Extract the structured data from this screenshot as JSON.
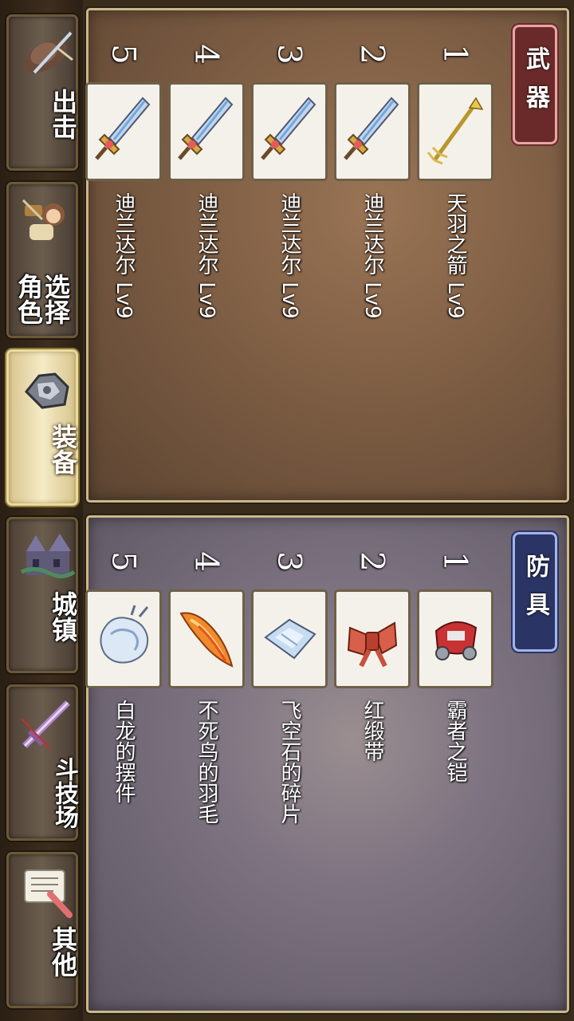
{
  "nav": {
    "items": [
      {
        "label": "出击",
        "icon": "hat-icon"
      },
      {
        "label": "选择角色",
        "label_line1": "选择",
        "label_line2": "角色",
        "icon": "character-icon"
      },
      {
        "label": "装备",
        "icon": "armor-icon",
        "active": true
      },
      {
        "label": "城镇",
        "icon": "castle-icon"
      },
      {
        "label": "斗技场",
        "icon": "sword-icon"
      },
      {
        "label": "其他",
        "icon": "scroll-icon"
      }
    ]
  },
  "weapons": {
    "title": "武器",
    "slots": [
      {
        "number": "1",
        "name": "天羽之箭 Lv9",
        "icon": "arrow-icon"
      },
      {
        "number": "2",
        "name": "迪兰达尔 Lv9",
        "icon": "sword-icon"
      },
      {
        "number": "3",
        "name": "迪兰达尔 Lv9",
        "icon": "sword-icon"
      },
      {
        "number": "4",
        "name": "迪兰达尔 Lv9",
        "icon": "sword-icon"
      },
      {
        "number": "5",
        "name": "迪兰达尔 Lv9",
        "icon": "sword-icon"
      }
    ]
  },
  "armor": {
    "title": "防具",
    "slots": [
      {
        "number": "1",
        "name": "霸者之铠",
        "icon": "red-armor-icon"
      },
      {
        "number": "2",
        "name": "红缎带",
        "icon": "ribbon-icon"
      },
      {
        "number": "3",
        "name": "飞空石的碎片",
        "icon": "crystal-shard-icon"
      },
      {
        "number": "4",
        "name": "不死鸟的羽毛",
        "icon": "feather-icon"
      },
      {
        "number": "5",
        "name": "白龙的摆件",
        "icon": "dragon-ornament-icon"
      }
    ]
  },
  "colors": {
    "weapons_tag": "#6b2a2a",
    "armor_tag": "#2a3565",
    "active_nav": "#f5ebc6"
  }
}
